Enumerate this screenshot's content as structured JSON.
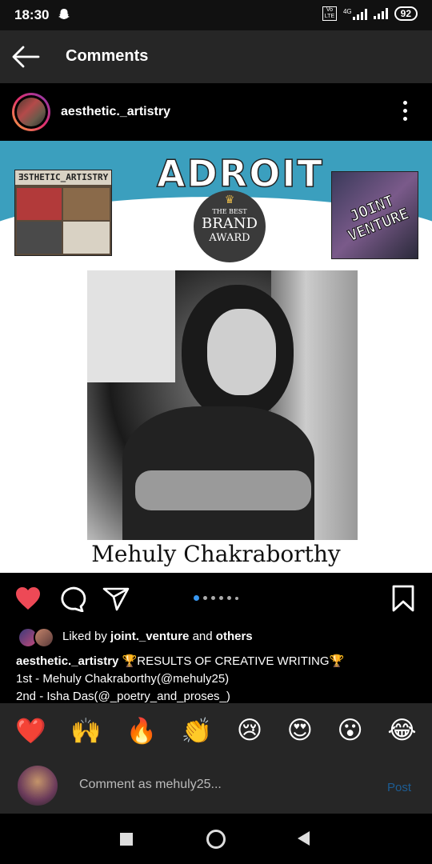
{
  "status_bar": {
    "time": "18:30",
    "network": "4G",
    "volte": "Vo LTE",
    "battery": "92"
  },
  "header": {
    "title": "Comments"
  },
  "post": {
    "username": "aesthetic._artistry",
    "image": {
      "left_logo_text": "ƎSTHETIC_ARTISTRY",
      "title": "ADROIT",
      "award_small": "THE BEST",
      "award_big": "BRAND",
      "award_bottom": "AWARD",
      "right_logo_text": "JOINT VENTURE",
      "caption": "Mehuly Chakraborthy"
    },
    "carousel": {
      "count": 6,
      "active": 0
    },
    "likes": {
      "prefix": "Liked by ",
      "user": "joint._venture",
      "mid": " and ",
      "others": "others"
    },
    "caption": {
      "author": "aesthetic._artistry",
      "line1": " 🏆RESULTS OF CREATIVE WRITING🏆",
      "line2": "1st - Mehuly Chakraborthy(@mehuly25)",
      "line3": "2nd - Isha Das(@_poetry_and_proses_)"
    }
  },
  "emoji_bar": [
    "❤️",
    "🙌",
    "🔥",
    "👏",
    "😢",
    "😍",
    "😮",
    "😂"
  ],
  "comment_input": {
    "placeholder": "Comment as mehuly25...",
    "post_label": "Post"
  },
  "colors": {
    "like_red": "#ed4956",
    "accent_blue": "#3897f0",
    "post_disabled": "#1d5d94",
    "banner_blue": "#3b9fbe"
  }
}
